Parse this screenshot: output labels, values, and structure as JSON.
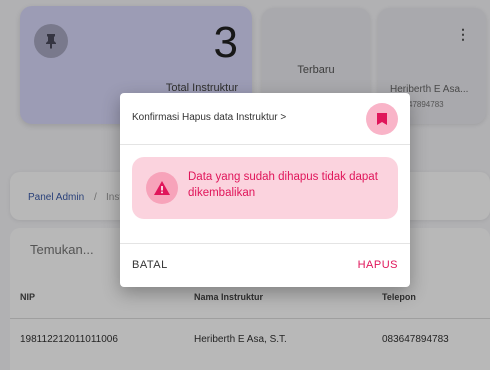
{
  "stats": {
    "total_count": "3",
    "total_label": "Total Instruktur",
    "newest_label": "Terbaru",
    "latest_name": "Heriberth E Asa...",
    "latest_phone": "47894783"
  },
  "breadcrumb": {
    "admin": "Panel Admin",
    "separator": "/",
    "current": "Inst"
  },
  "search": {
    "placeholder": "Temukan..."
  },
  "table": {
    "headers": [
      "NIP",
      "Nama Instruktur",
      "Telepon"
    ],
    "rows": [
      [
        "198112212011011006",
        "Heriberth E Asa, S.T.",
        "083647894783"
      ]
    ]
  },
  "dialog": {
    "title": "Konfirmasi Hapus data Instruktur >",
    "message": "Data yang sudah dihapus tidak dapat dikembalikan",
    "cancel_label": "BATAL",
    "delete_label": "HAPUS"
  },
  "colors": {
    "accent": "#e0155a",
    "alert_bg": "#fbd3de",
    "stat_card": "#d9d9fb"
  },
  "icons": {
    "stat": "pin-icon",
    "menu": "kebab-menu-icon",
    "dialog": "bookmark-icon",
    "alert": "warning-icon"
  }
}
